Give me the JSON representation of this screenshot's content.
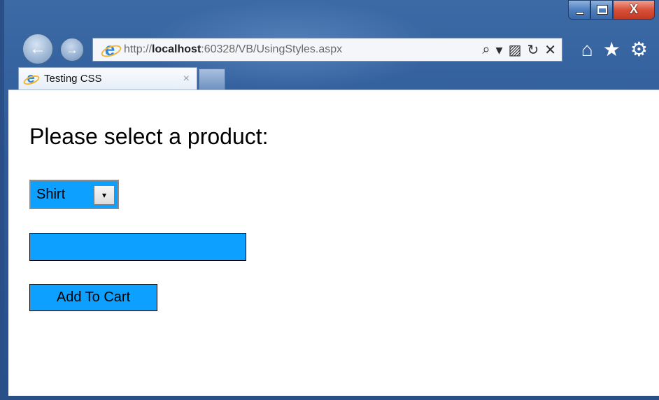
{
  "browser": {
    "window_controls": {
      "minimize": "–",
      "maximize": "□",
      "close": "X"
    },
    "nav": {
      "back_icon": "←",
      "forward_icon": "→"
    },
    "address": {
      "url_prefix": "http://",
      "url_host": "localhost",
      "url_rest": ":60328/VB/UsingStyles.aspx",
      "tools": {
        "search": "⌕",
        "dropdown": "▾",
        "compat": "▨",
        "refresh": "↻",
        "stop": "✕"
      }
    },
    "toolbar_icons": {
      "home": "⌂",
      "favorites": "★",
      "settings": "⚙"
    },
    "tab": {
      "title": "Testing CSS",
      "close": "×"
    }
  },
  "page": {
    "heading": "Please select a product:",
    "product_select": {
      "selected": "Shirt",
      "arrow": "▾"
    },
    "quantity_input": {
      "value": ""
    },
    "add_button_label": "Add To Cart"
  },
  "colors": {
    "accent": "#0ea0ff",
    "frame": "#2e5b98",
    "close_button": "#d8503a"
  }
}
